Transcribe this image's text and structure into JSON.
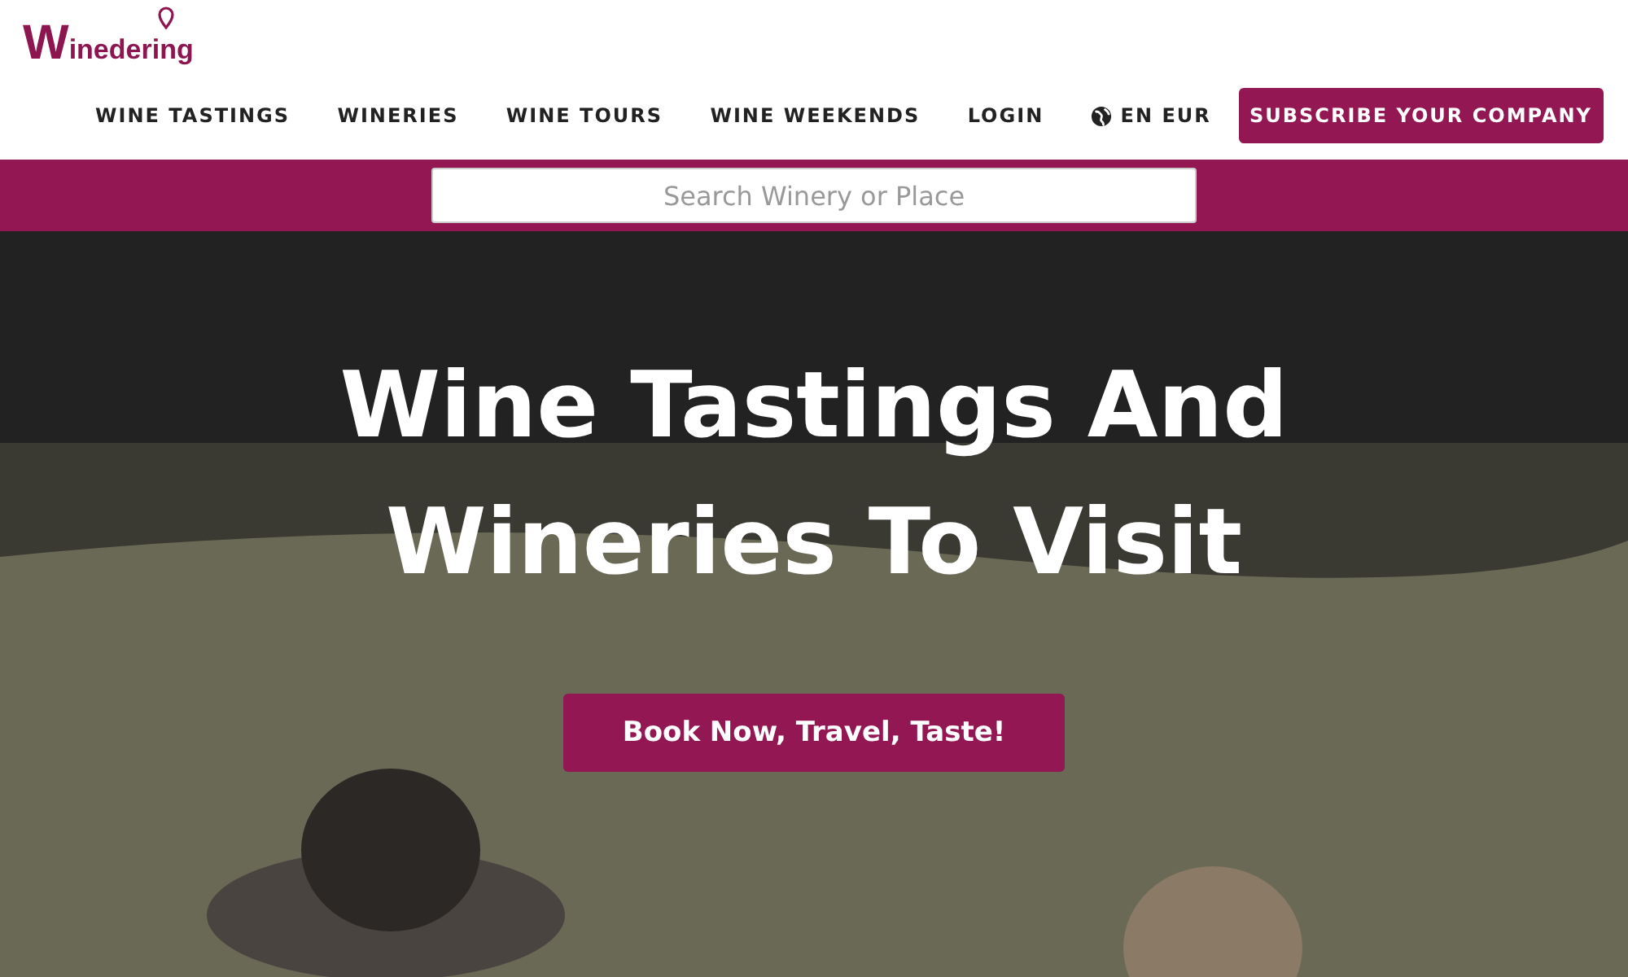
{
  "logo": {
    "text": "Winedering"
  },
  "nav": {
    "items": [
      {
        "label": "WINE TASTINGS"
      },
      {
        "label": "WINERIES"
      },
      {
        "label": "WINE TOURS"
      },
      {
        "label": "WINE WEEKENDS"
      },
      {
        "label": "LOGIN"
      }
    ],
    "language": "EN EUR",
    "cta": "SUBSCRIBE YOUR COMPANY"
  },
  "search": {
    "placeholder": "Search Winery or Place"
  },
  "hero": {
    "title": "Wine Tastings And Wineries To Visit",
    "button": "Book Now, Travel, Taste!"
  }
}
